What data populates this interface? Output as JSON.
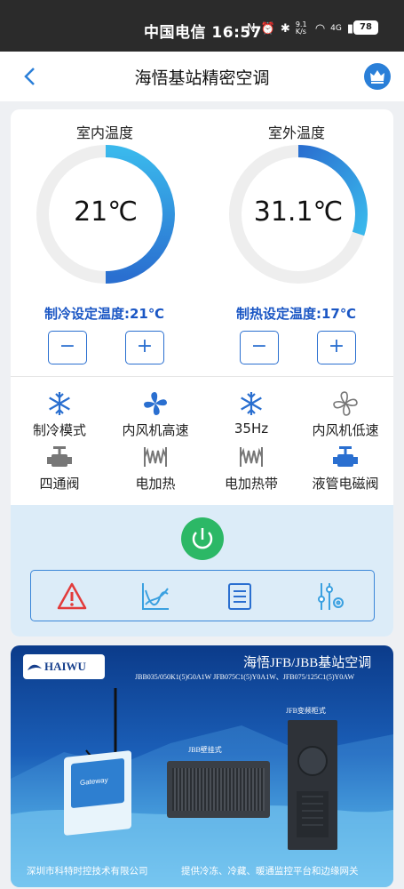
{
  "status_bar": {
    "carrier_time": "中国电信 16:57",
    "net_speed": "9.1 K/s",
    "signal": "4G",
    "battery": "78"
  },
  "header": {
    "title": "海悟基站精密空调"
  },
  "indoor": {
    "title": "室内温度",
    "value": "21℃",
    "gauge_fraction": 0.5,
    "setpoint_label": "制冷设定温度:21℃"
  },
  "outdoor": {
    "title": "室外温度",
    "value": "31.1℃",
    "gauge_fraction": 0.3,
    "setpoint_label": "制热设定温度:17℃"
  },
  "steppers": {
    "minus": "−",
    "plus": "+"
  },
  "status_items": [
    {
      "label": "制冷模式",
      "icon": "snowflake-icon",
      "active": true
    },
    {
      "label": "内风机高速",
      "icon": "fan-icon",
      "active": true
    },
    {
      "label": "35Hz",
      "icon": "snowflake-icon",
      "active": true
    },
    {
      "label": "内风机低速",
      "icon": "fan-icon",
      "active": false
    },
    {
      "label": "四通阀",
      "icon": "valve-icon",
      "active": false
    },
    {
      "label": "电加热",
      "icon": "heater-icon",
      "active": false
    },
    {
      "label": "电加热带",
      "icon": "heater-icon",
      "active": false
    },
    {
      "label": "液管电磁阀",
      "icon": "valve-icon",
      "active": true
    }
  ],
  "toolbar": [
    "alarm-icon",
    "chart-icon",
    "list-icon",
    "settings-icon"
  ],
  "banner": {
    "logo": "HAIWU",
    "title": "海悟JFB/JBB基站空调",
    "models": "JBB035/050K1(5)G0A1W    JFB075C1(5)Y0A1W、JFB075/125C1(5)Y0AW",
    "tag_jfb": "JFB变频柜式",
    "tag_jbb": "JBB壁挂式",
    "gateway": "Gateway",
    "footer_left": "深圳市科特时控技术有限公司",
    "footer_right": "提供冷冻、冷藏、暖通监控平台和边缘网关"
  },
  "colors": {
    "accent": "#2a6fd0",
    "gauge_active": "#3ab8ec",
    "inactive_icon": "#777777",
    "power": "#2cb866",
    "alarm": "#e23b3b"
  }
}
